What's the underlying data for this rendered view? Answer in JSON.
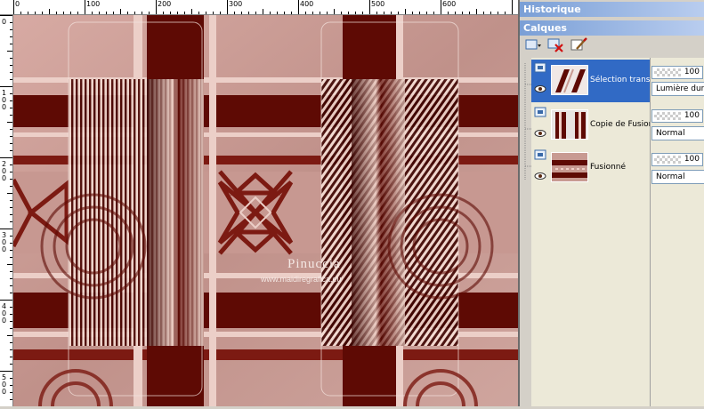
{
  "rulers": {
    "top_labels": [
      "0",
      "100",
      "200",
      "300",
      "400",
      "500",
      "600"
    ],
    "left_labels": [
      "0",
      "1\n0\n0",
      "2\n0\n0",
      "3\n0\n0",
      "4\n0\n0",
      "5\n0\n0"
    ]
  },
  "watermark": {
    "line1": "Pinuccia",
    "line2": "www.maidiregrafica.eu"
  },
  "panels": {
    "history_title": "Historique",
    "layers_title": "Calques"
  },
  "toolbar": {
    "icons": [
      "new-layer-icon",
      "delete-layer-icon",
      "edit-layer-icon"
    ]
  },
  "layers": [
    {
      "name": "Sélection transformée",
      "selected": true,
      "opacity": "100",
      "blend": "Lumière dure"
    },
    {
      "name": "Copie de Fusionné",
      "selected": false,
      "opacity": "100",
      "blend": "Normal"
    },
    {
      "name": "Fusionné",
      "selected": false,
      "opacity": "100",
      "blend": "Normal"
    }
  ],
  "colors": {
    "panel_title_from": "#7a9fd6",
    "panel_title_to": "#b9cdef",
    "selection": "#316ac5",
    "maroon": "#5e0a04",
    "rose": "#c89a92"
  }
}
